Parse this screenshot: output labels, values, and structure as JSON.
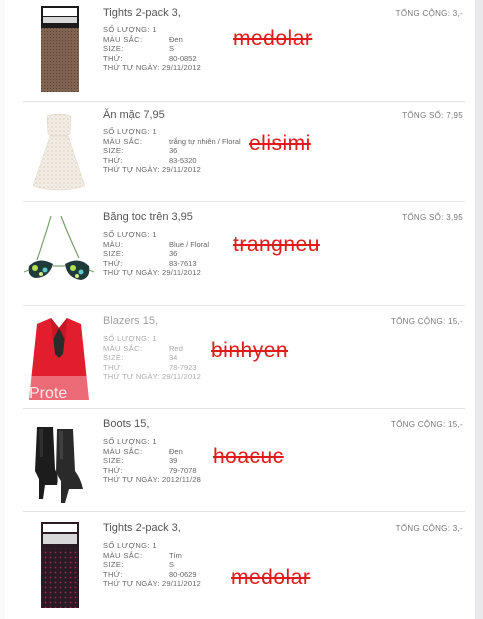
{
  "items": [
    {
      "title": "Tights 2-pack 3,",
      "total_label": "TỔNG CỘNG: 3,-",
      "rows": [
        {
          "label": "SỐ LƯỢNG: 1",
          "value": ""
        },
        {
          "label": "MÀU SẮC:",
          "value": "Đen"
        },
        {
          "label": "SIZE:",
          "value": "S"
        },
        {
          "label": "THỨ:",
          "value": "80-0852"
        }
      ],
      "date_line": "THỨ TỰ NGÀY: 29/11/2012",
      "handwriting": "medolar",
      "image": "tights-black-brown"
    },
    {
      "title": "Ăn mặc 7,95",
      "total_label": "TỔNG SỐ: 7,95",
      "rows": [
        {
          "label": "SỐ LƯỢNG: 1",
          "value": ""
        },
        {
          "label": "MÀU SẮC:",
          "value": "trắng tự nhiên / Floral"
        },
        {
          "label": "SIZE:",
          "value": "36"
        },
        {
          "label": "THỨ:",
          "value": "83-5320"
        }
      ],
      "date_line": "THỨ TỰ NGÀY: 29/11/2012",
      "handwriting": "elisimi",
      "image": "white-floral-dress"
    },
    {
      "title": "Băng toc trên     3,95",
      "total_label": "TỔNG SỐ: 3,95",
      "rows": [
        {
          "label": "SỐ LƯỢNG: 1",
          "value": ""
        },
        {
          "label": "MÀU:",
          "value": "Blue / Floral"
        },
        {
          "label": "SIZE:",
          "value": "36"
        },
        {
          "label": "THỨ:",
          "value": "83-7613"
        }
      ],
      "date_line": "THỨ TỰ NGÀY: 29/11/2012",
      "handwriting": "trangneu",
      "image": "floral-bikini-top"
    },
    {
      "title": "Blazers 15,",
      "total_label": "TỔNG CỘNG: 15,-",
      "rows": [
        {
          "label": "SỐ LƯỢNG: 1",
          "value": ""
        },
        {
          "label": "MÀU SẮC:",
          "value": "Red"
        },
        {
          "label": "SIZE:",
          "value": "34"
        },
        {
          "label": "THỨ:",
          "value": "78-7923"
        }
      ],
      "date_line": "THỨ TỰ NGÀY: 29/11/2012",
      "handwriting": "binhyen",
      "image_overlay_text": "Prote",
      "image": "red-blazer"
    },
    {
      "title": "Boots 15,",
      "total_label": "TỔNG CỘNG: 15,-",
      "rows": [
        {
          "label": "SỐ LƯỢNG: 1",
          "value": ""
        },
        {
          "label": "MÀU SẮC:",
          "value": "Đen"
        },
        {
          "label": "SIZE:",
          "value": "39"
        },
        {
          "label": "THỨ:",
          "value": "79-7078"
        }
      ],
      "date_line": "THỨ TỰ NGÀY: 2012/11/28",
      "handwriting": "hoacuc",
      "image": "black-ankle-boots"
    },
    {
      "title": "Tights 2-pack 3,",
      "total_label": "TỔNG CỘNG: 3,-",
      "rows": [
        {
          "label": "SỐ LƯỢNG: 1",
          "value": ""
        },
        {
          "label": "MÀU SẮC:",
          "value": "Tím"
        },
        {
          "label": "SIZE:",
          "value": "S"
        },
        {
          "label": "THỨ:",
          "value": "80-0629"
        }
      ],
      "date_line": "THỨ TỰ NGÀY: 29/11/2012",
      "handwriting": "medolar",
      "image": "tights-dark-purple"
    }
  ],
  "colors": {
    "handwriting": "#e01b1b",
    "text": "#555555",
    "divider": "#e3e3e3",
    "blazer": "#e21d2e"
  }
}
